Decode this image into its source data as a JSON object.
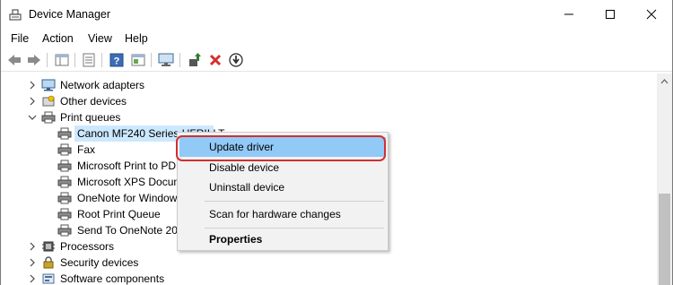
{
  "window": {
    "title": "Device Manager",
    "controls": {
      "minimize": "minimize-icon",
      "maximize": "maximize-icon",
      "close": "close-icon"
    }
  },
  "menubar": {
    "items": [
      "File",
      "Action",
      "View",
      "Help"
    ]
  },
  "toolbar": {
    "buttons": [
      "back-arrow-icon",
      "forward-arrow-icon",
      "show-hide-console-tree-icon",
      "properties-icon",
      "help-icon",
      "action-pane-icon",
      "monitor-icon",
      "update-driver-icon",
      "uninstall-icon",
      "download-icon"
    ],
    "colors": {
      "uninstall": "#d32f2f",
      "update": "#2e7d32"
    }
  },
  "tree": {
    "rows": [
      {
        "label": "Network adapters",
        "level": 0,
        "expanded": false,
        "icon": "network-adapter-icon"
      },
      {
        "label": "Other devices",
        "level": 0,
        "expanded": false,
        "icon": "other-devices-icon"
      },
      {
        "label": "Print queues",
        "level": 0,
        "expanded": true,
        "icon": "printer-icon"
      },
      {
        "label": "Canon MF240 Series UFRII LT",
        "level": 1,
        "selected": true,
        "icon": "printer-icon"
      },
      {
        "label": "Fax",
        "level": 1,
        "icon": "printer-icon"
      },
      {
        "label": "Microsoft Print to PDF",
        "level": 1,
        "icon": "printer-icon"
      },
      {
        "label": "Microsoft XPS Document Writer",
        "level": 1,
        "icon": "printer-icon"
      },
      {
        "label": "OneNote for Windows 10",
        "level": 1,
        "icon": "printer-icon"
      },
      {
        "label": "Root Print Queue",
        "level": 1,
        "icon": "printer-icon"
      },
      {
        "label": "Send To OneNote 2016",
        "level": 1,
        "icon": "printer-icon"
      },
      {
        "label": "Processors",
        "level": 0,
        "expanded": false,
        "icon": "processor-icon"
      },
      {
        "label": "Security devices",
        "level": 0,
        "expanded": false,
        "icon": "security-device-icon"
      },
      {
        "label": "Software components",
        "level": 0,
        "expanded": false,
        "icon": "software-component-icon"
      }
    ],
    "selection_color": "#cce8ff"
  },
  "context_menu": {
    "items": [
      {
        "label": "Update driver",
        "highlighted": true
      },
      {
        "label": "Disable device"
      },
      {
        "label": "Uninstall device"
      },
      {
        "label": "Scan for hardware changes"
      },
      {
        "label": "Properties",
        "bold": true
      }
    ],
    "highlight_color": "#91c9f7",
    "annotation_color": "#d32f2f"
  }
}
